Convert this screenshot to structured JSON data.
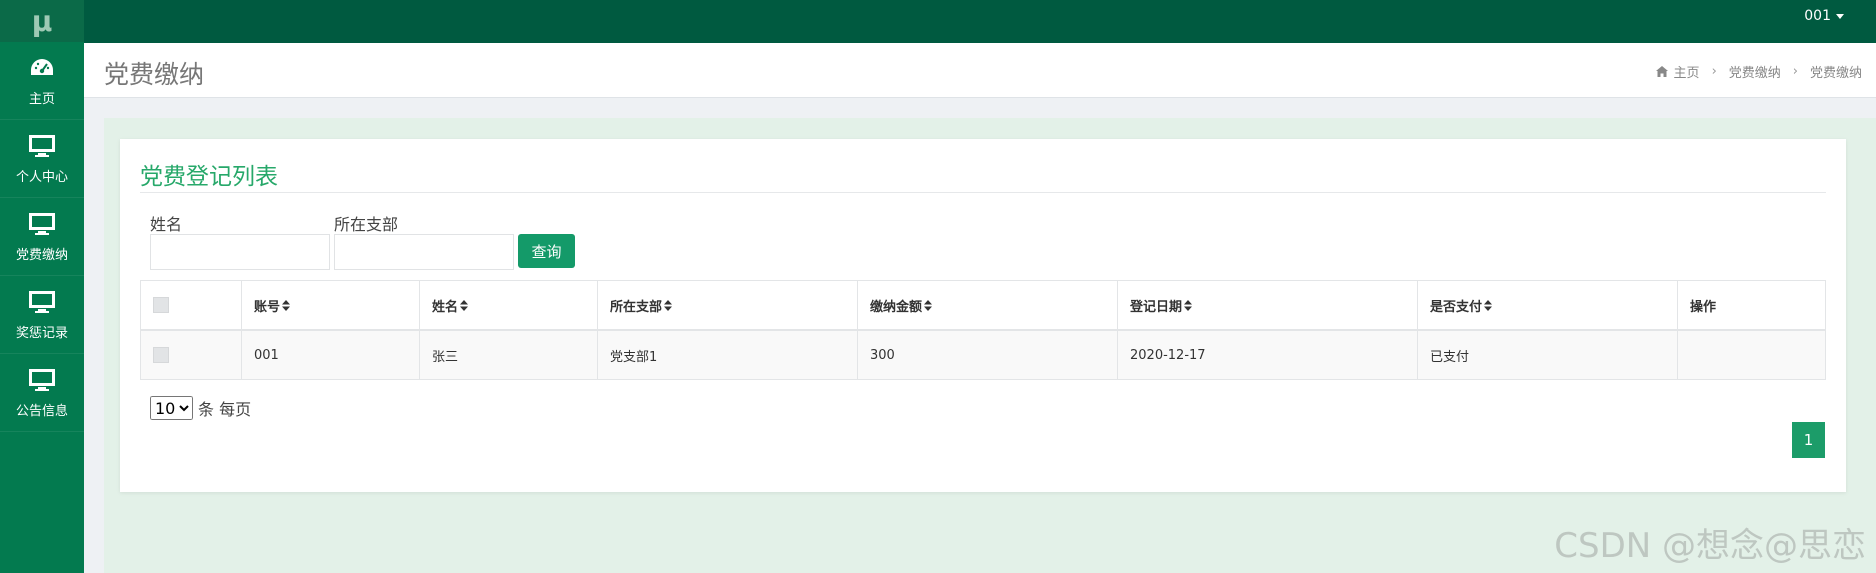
{
  "app": {
    "logo_text": "μ"
  },
  "sidebar": {
    "items": [
      {
        "label": "主页",
        "icon": "dashboard-icon"
      },
      {
        "label": "个人中心",
        "icon": "monitor-icon"
      },
      {
        "label": "党费缴纳",
        "icon": "monitor-icon"
      },
      {
        "label": "奖惩记录",
        "icon": "monitor-icon"
      },
      {
        "label": "公告信息",
        "icon": "monitor-icon"
      }
    ]
  },
  "topbar": {
    "user": "001"
  },
  "header": {
    "title": "党费缴纳",
    "breadcrumb": [
      "主页",
      "党费缴纳",
      "党费缴纳"
    ]
  },
  "panel": {
    "title": "党费登记列表",
    "filters": {
      "name_label": "姓名",
      "name_value": "",
      "branch_label": "所在支部",
      "branch_value": ""
    },
    "search_label": "查询",
    "table": {
      "columns": [
        "账号",
        "姓名",
        "所在支部",
        "缴纳金额",
        "登记日期",
        "是否支付",
        "操作"
      ],
      "rows": [
        [
          "001",
          "张三",
          "党支部1",
          "300",
          "2020-12-17",
          "已支付",
          ""
        ]
      ]
    },
    "page_size": {
      "value": "10",
      "suffix": "条 每页"
    },
    "pagination": {
      "current": "1"
    }
  },
  "watermark": "CSDN @想念@思恋",
  "colors": {
    "sidebar": "#037a4f",
    "topbar": "#005a40",
    "accent": "#1c9c69",
    "title_green": "#27a86a"
  }
}
